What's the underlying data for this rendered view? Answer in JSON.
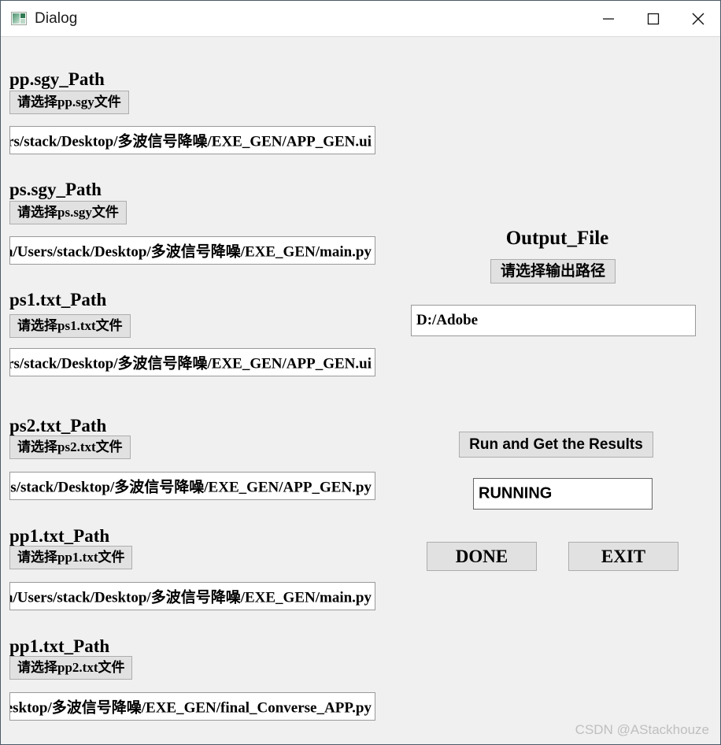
{
  "window": {
    "title": "Dialog",
    "icon": "app-window-icon",
    "controls": {
      "minimize": "—",
      "maximize": "□",
      "close": "✕"
    },
    "colors": {
      "titlebar_bg": "#ffffff",
      "content_bg": "#f0f0f0",
      "button_bg": "#e1e1e1",
      "button_border": "#adadad",
      "field_bg": "#ffffff",
      "field_border": "#999999",
      "window_border": "#4a5a66",
      "text": "#000000",
      "watermark": "#bfbfbf"
    }
  },
  "left_panel": {
    "groups": [
      {
        "label": "pp.sgy_Path",
        "button_label": "请选择pp.sgy文件",
        "path_value": "sers/stack/Desktop/多波信号降噪/EXE_GEN/APP_GEN.ui"
      },
      {
        "label": "ps.sgy_Path",
        "button_label": "请选择ps.sgy文件",
        "path_value": "ata/Users/stack/Desktop/多波信号降噪/EXE_GEN/main.py"
      },
      {
        "label": "ps1.txt_Path",
        "button_label": "请选择ps1.txt文件",
        "path_value": "sers/stack/Desktop/多波信号降噪/EXE_GEN/APP_GEN.ui"
      },
      {
        "label": "ps2.txt_Path",
        "button_label": "请选择ps2.txt文件",
        "path_value": "ers/stack/Desktop/多波信号降噪/EXE_GEN/APP_GEN.py"
      },
      {
        "label": "pp1.txt_Path",
        "button_label": "请选择pp1.txt文件",
        "path_value": "ata/Users/stack/Desktop/多波信号降噪/EXE_GEN/main.py"
      },
      {
        "label": "pp1.txt_Path",
        "button_label": "请选择pp2.txt文件",
        "path_value": "Desktop/多波信号降噪/EXE_GEN/final_Converse_APP.py"
      }
    ]
  },
  "right_panel": {
    "output_title": "Output_File",
    "output_button_label": "请选择输出路径",
    "output_path_value": "D:/Adobe",
    "run_button_label": "Run and Get the Results",
    "status_value": "RUNNING",
    "done_button_label": "DONE",
    "exit_button_label": "EXIT"
  },
  "watermark": "CSDN @AStackhouze"
}
